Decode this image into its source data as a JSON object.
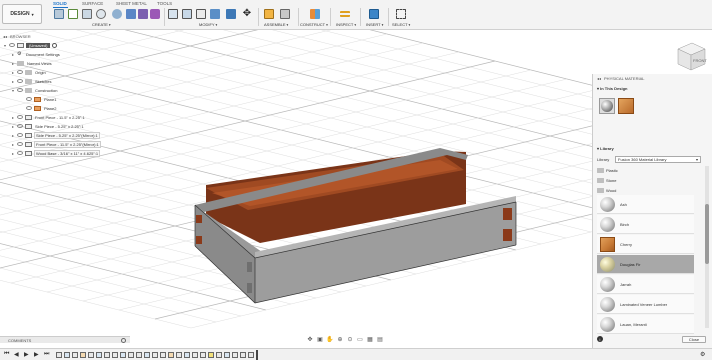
{
  "toolbar": {
    "workspace_button": "DESIGN",
    "tabs": [
      "SOLID",
      "SURFACE",
      "SHEET METAL",
      "TOOLS"
    ],
    "groups": [
      "CREATE",
      "MODIFY",
      "ASSEMBLE",
      "CONSTRUCT",
      "INSPECT",
      "INSERT",
      "SELECT"
    ]
  },
  "browser": {
    "title": "BROWSER",
    "root_label": "(Unsaved)",
    "items": [
      "Document Settings",
      "Named Views",
      "Origin",
      "Sketches",
      "Construction",
      "Plane1",
      "Plane2",
      "Front Piece - 11.5\" x 2.25\":1",
      "Side Piece - 5.25\" x 2.25\":1",
      "Side Piece - 5.25\" x 2.25\"(Mirror):1",
      "Front Piece - 11.5\" x 2.25\"(Mirror):1",
      "Wood Base - 3/16\" x 11\" x 4.625\":1"
    ]
  },
  "viewcube": {
    "face_label": "FRONT"
  },
  "panel": {
    "title": "PHYSICAL MATERIAL",
    "in_design_label": "In This Design",
    "library_section": "Library",
    "library_label": "Library",
    "library_value": "Fusion 360 Material Library",
    "categories": [
      "Plastic",
      "Stone",
      "Wood"
    ],
    "materials": [
      "Ash",
      "Birch",
      "Cherry",
      "Douglas Fir",
      "Jarrah",
      "Laminated Veneer Lumber",
      "Lauan, Meranti"
    ],
    "selected_material": "Douglas Fir",
    "close_label": "Close"
  },
  "comments": {
    "label": "COMMENTS"
  },
  "colors": {
    "accent": "#1a73c9",
    "wood_interior": "#8b3a1a",
    "metal_outer": "#8f8f8f",
    "selected_row": "#a8a8a8"
  }
}
